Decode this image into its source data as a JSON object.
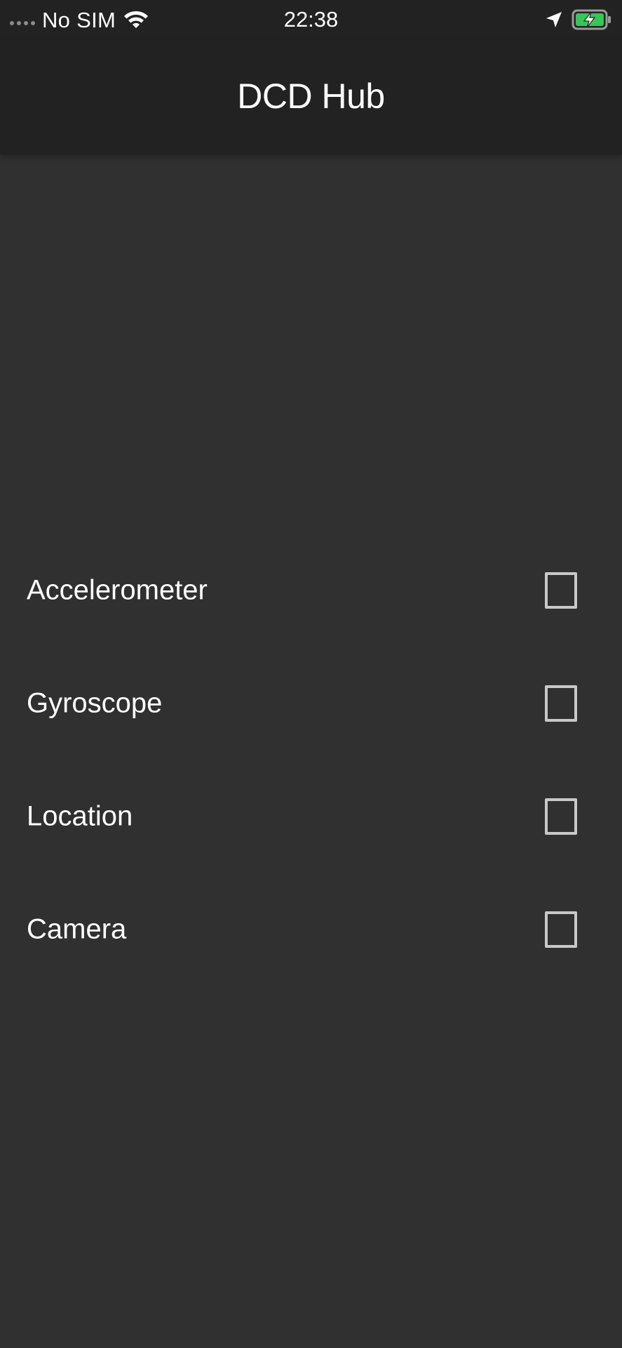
{
  "status_bar": {
    "carrier": "No SIM",
    "time": "22:38",
    "icons": [
      "signal-dots-icon",
      "wifi-icon",
      "location-arrow-icon",
      "battery-charging-icon"
    ],
    "battery_color": "#34c759"
  },
  "nav": {
    "title": "DCD Hub"
  },
  "sensors": [
    {
      "label": "Accelerometer",
      "checked": false
    },
    {
      "label": "Gyroscope",
      "checked": false
    },
    {
      "label": "Location",
      "checked": false
    },
    {
      "label": "Camera",
      "checked": false
    }
  ],
  "colors": {
    "background": "#303030",
    "bar": "#222222",
    "checkbox_border": "#c8c8c8"
  }
}
